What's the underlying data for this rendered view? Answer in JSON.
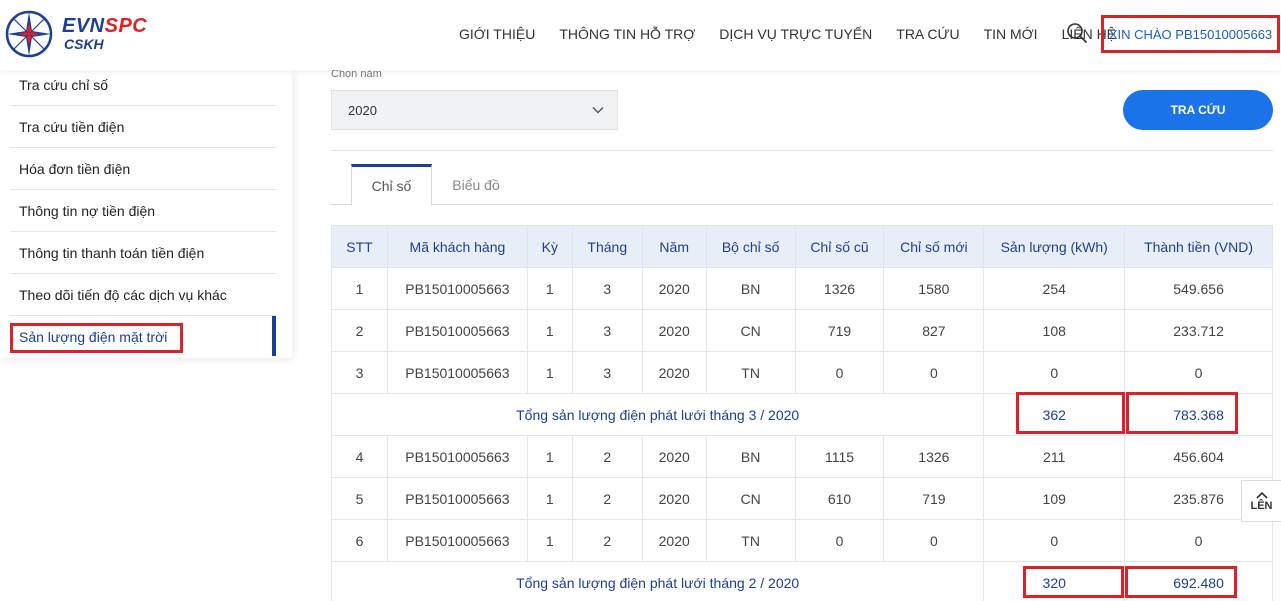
{
  "brand": {
    "name_a": "EVN",
    "name_b": "SPC",
    "sub": "CSKH"
  },
  "nav": {
    "items": [
      "GIỚI THIỆU",
      "THÔNG TIN HỖ TRỢ",
      "DỊCH VỤ TRỰC TUYẾN",
      "TRA CỨU",
      "TIN MỚI",
      "LIÊN HỆ"
    ],
    "greeting": "XIN CHÀO PB15010005663"
  },
  "sidebar": {
    "items": [
      "Tra cứu chỉ số",
      "Tra cứu tiền điện",
      "Hóa đơn tiền điện",
      "Thông tin nợ tiền điện",
      "Thông tin thanh toán tiền điện",
      "Theo dõi tiến độ các dịch vụ khác",
      "Sản lượng điện mặt trời"
    ]
  },
  "form": {
    "year_label": "Chọn năm",
    "year_value": "2020",
    "search_button": "TRA CỨU"
  },
  "tabs": [
    "Chỉ số",
    "Biểu đồ"
  ],
  "table": {
    "headers": [
      "STT",
      "Mã khách hàng",
      "Kỳ",
      "Tháng",
      "Năm",
      "Bộ chỉ số",
      "Chỉ số cũ",
      "Chỉ số mới",
      "Sản lượng (kWh)",
      "Thành tiền (VND)"
    ],
    "rows": [
      [
        "1",
        "PB15010005663",
        "1",
        "3",
        "2020",
        "BN",
        "1326",
        "1580",
        "254",
        "549.656"
      ],
      [
        "2",
        "PB15010005663",
        "1",
        "3",
        "2020",
        "CN",
        "719",
        "827",
        "108",
        "233.712"
      ],
      [
        "3",
        "PB15010005663",
        "1",
        "3",
        "2020",
        "TN",
        "0",
        "0",
        "0",
        "0"
      ],
      [
        "4",
        "PB15010005663",
        "1",
        "2",
        "2020",
        "BN",
        "1115",
        "1326",
        "211",
        "456.604"
      ],
      [
        "5",
        "PB15010005663",
        "1",
        "2",
        "2020",
        "CN",
        "610",
        "719",
        "109",
        "235.876"
      ],
      [
        "6",
        "PB15010005663",
        "1",
        "2",
        "2020",
        "TN",
        "0",
        "0",
        "0",
        "0"
      ]
    ],
    "summaries": [
      {
        "label": "Tổng sản lượng điện phát lưới tháng 3 / 2020",
        "kwh": "362",
        "amount": "783.368"
      },
      {
        "label": "Tổng sản lượng điện phát lưới tháng 2 / 2020",
        "kwh": "320",
        "amount": "692.480"
      }
    ]
  },
  "back_to_top": "LÊN",
  "colors": {
    "brand_blue": "#1b3f94",
    "brand_red": "#e31e24",
    "button_blue": "#1a73e8",
    "highlight_red": "#d9232a"
  }
}
